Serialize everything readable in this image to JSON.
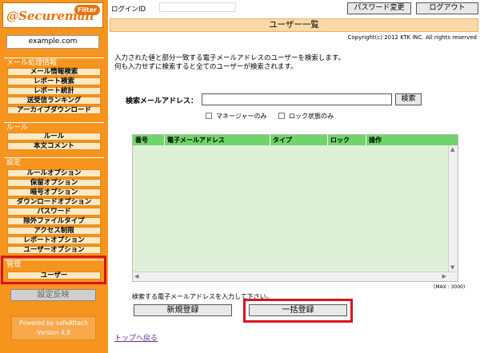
{
  "sidebar": {
    "logo_text": "@Securemail",
    "logo_badge": "Filter",
    "domain": "example.com",
    "sections": {
      "mail_processing": {
        "header": "メール処理情報",
        "items": [
          "メール情報検索",
          "レポート検索",
          "レポート統計",
          "送受信ランキング",
          "アーカイブダウンロード"
        ]
      },
      "rules": {
        "header": "ルール",
        "items": [
          "ルール",
          "本文コメント"
        ]
      },
      "settings": {
        "header": "設定",
        "items": [
          "ルールオプション",
          "保留オプション",
          "暗号オプション",
          "ダウンロードオプション",
          "パスワード",
          "除外ファイルタイプ",
          "アクセス制限",
          "レポートオプション",
          "ユーザーオプション"
        ]
      },
      "admin": {
        "header": "管理",
        "items": [
          "ユーザー"
        ]
      }
    },
    "reflect_button": "設定反映",
    "powered_line1": "Powered by safeAttach",
    "powered_line2": "Version 4.8"
  },
  "header": {
    "login_label": "ログインID",
    "login_value": "",
    "password_button": "パスワード変更",
    "logout_button": "ログアウト"
  },
  "page": {
    "title": "ユーザー一覧",
    "copyright": "Copyright(c) 2012 KTK INC. All rights reserved",
    "desc_line1": "入力された値と部分一致する電子メールアドレスのユーザーを検索します。",
    "desc_line2": "何も入力せずに検索すると全てのユーザーが検索されます。"
  },
  "search": {
    "label": "検索メールアドレス：",
    "value": "",
    "button": "検索",
    "manager_only": "マネージャーのみ",
    "locked_only": "ロック状態のみ"
  },
  "table": {
    "columns": [
      "番号",
      "電子メールアドレス",
      "タイプ",
      "ロック",
      "操作"
    ],
    "rows": []
  },
  "footer": {
    "max_note": "(MAX : 3000)",
    "hint": "検索する電子メールアドレスを入力して下さい。",
    "new_button": "新規登録",
    "bulk_button": "一括登録",
    "top_link": "トップへ戻る"
  },
  "colors": {
    "sidebar_bg": "#f7941d",
    "nav_item_bg": "#fde9c4",
    "title_bar_bg": "#fcd9a6",
    "table_header": "#6fd56a",
    "table_body": "#dff0d8",
    "highlight": "#d9151b"
  }
}
